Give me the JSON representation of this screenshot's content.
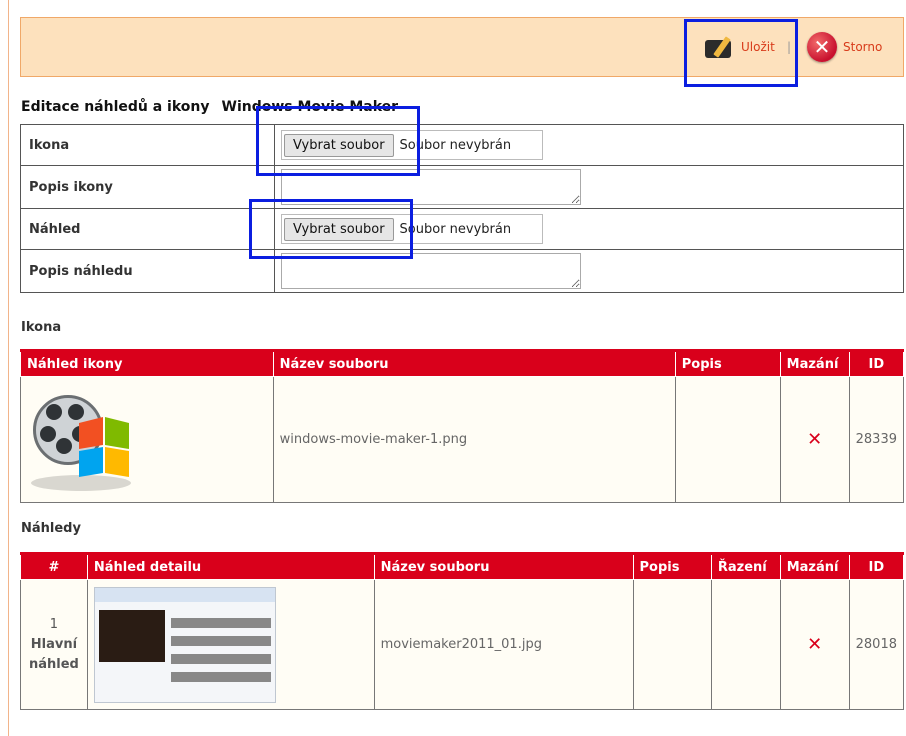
{
  "toolbar": {
    "save_label": "Uložit",
    "separator": "|",
    "cancel_label": "Storno"
  },
  "page": {
    "title": "Editace náhledů a ikony",
    "name": "Windows Movie Maker"
  },
  "form": {
    "icon_label": "Ikona",
    "icon_button": "Vybrat soubor",
    "icon_status": "Soubor nevybrán",
    "icon_desc_label": "Popis ikony",
    "preview_label": "Náhled",
    "preview_button": "Vybrat soubor",
    "preview_status": "Soubor nevybrán",
    "preview_desc_label": "Popis náhledu"
  },
  "icon_section": {
    "title": "Ikona",
    "columns": [
      "Náhled ikony",
      "Název souboru",
      "Popis",
      "Mazání",
      "ID"
    ],
    "row": {
      "filename": "windows-movie-maker-1.png",
      "description": "",
      "delete": "✕",
      "id": "28339"
    }
  },
  "preview_section": {
    "title": "Náhledy",
    "columns": [
      "#",
      "Náhled detailu",
      "Název souboru",
      "Popis",
      "Řazení",
      "Mazání",
      "ID"
    ],
    "row": {
      "order": "1",
      "main_1": "Hlavní",
      "main_2": "náhled",
      "filename": "moviemaker2011_01.jpg",
      "description": "",
      "sorting": "",
      "delete": "✕",
      "id": "28018"
    }
  },
  "colors": {
    "header_red": "#d9001b",
    "toolbar_bg": "#fde1bd",
    "highlight_blue": "#0b1ee0"
  }
}
